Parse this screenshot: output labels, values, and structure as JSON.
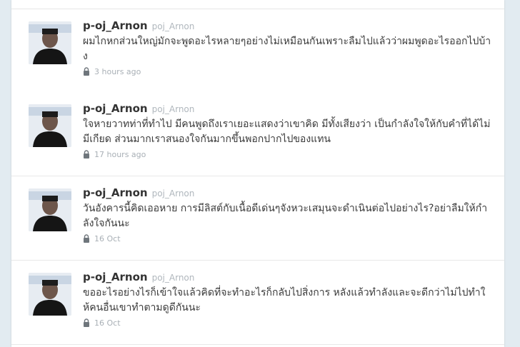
{
  "colors": {
    "page_background": "#e2ebf1",
    "card_background": "#ffffff",
    "username": "#333333",
    "handle": "#b0b7bd",
    "text": "#3b3b3b",
    "meta": "#a9b0b6"
  },
  "tweets": [
    {
      "username": "p-oj_Arnon",
      "handle": "poj_Arnon",
      "text": "ผมไกหกส่วนใหญ่มักจะพูดอะไรหลายๆอย่างไม่เหมือนกันเพราะลืมไปแล้วว่าผมพูดอะไรออกไปบ้าง",
      "time": "3 hours ago",
      "meta_icon": "lock-icon",
      "avatar_icon": "user-avatar-icon"
    },
    {
      "username": "p-oj_Arnon",
      "handle": "poj_Arnon",
      "text": "ใจหายวาทท่าที่ทำไป มีคนพูดถึงเราเยอะแสดงว่าเขาคิด มีทั้งเสียงว่า เป็นกำลังใจให้กับคำที่ได้ไม่มีเกียด ส่วนมากเราสนองใจกันมากขึ้นพอกปากไปของแทน",
      "time": "17 hours ago",
      "meta_icon": "lock-icon",
      "avatar_icon": "user-avatar-icon"
    },
    {
      "username": "p-oj_Arnon",
      "handle": "poj_Arnon",
      "text": "วันอังคารนี้คิดเออหาย การมีลิสต์กับเนื้อดีเด่นๆจังหวะเสมุนจะดำเนินต่อไปอย่างไร?อย่าลืมให้กำลังใจกันนะ",
      "time": "16 Oct",
      "meta_icon": "lock-icon",
      "avatar_icon": "user-avatar-icon"
    },
    {
      "username": "p-oj_Arnon",
      "handle": "poj_Arnon",
      "text": "ขออะไรอย่างไรก็เข้าใจแล้วคิดที่จะทำอะไรก็กลับไปสิ่งการ หลังแล้วทำลังและจะดีกว่าไม่ไปทำให้คนอื่นเขาทำตามดูดีกันนะ",
      "time": "16 Oct",
      "meta_icon": "lock-icon",
      "avatar_icon": "user-avatar-icon"
    }
  ]
}
